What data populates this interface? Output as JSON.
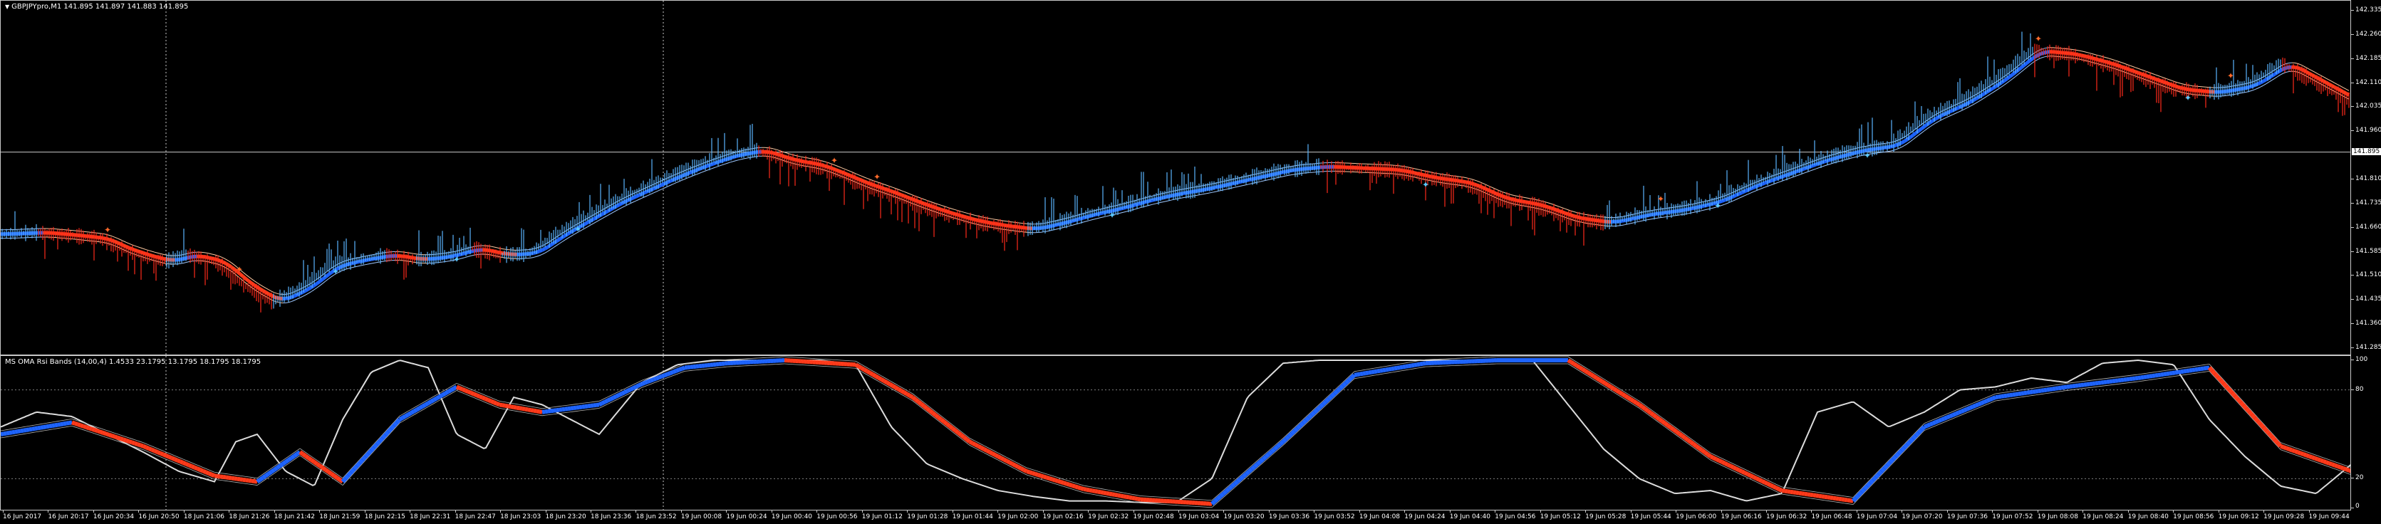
{
  "price_pane": {
    "title": "GBPJPYpro,M1  141.895 141.897 141.883 141.895",
    "collapse_arrow": "▼",
    "axis_ticks": [
      "142.335",
      "142.260",
      "142.185",
      "142.110",
      "142.035",
      "141.960",
      "141.810",
      "141.735",
      "141.660",
      "141.585",
      "141.510",
      "141.435",
      "141.360",
      "141.285"
    ],
    "axis_values": [
      142.335,
      142.26,
      142.185,
      142.11,
      142.035,
      141.96,
      141.81,
      141.735,
      141.66,
      141.585,
      141.51,
      141.435,
      141.36,
      141.285
    ],
    "current_price_label": "141.895",
    "current_price": 141.895,
    "y_range": [
      141.285,
      142.335
    ]
  },
  "osc_pane": {
    "title": "MS OMA Rsi Bands (14,00,4) 1.4533 23.1795 13.1795 18.1795 18.1795",
    "axis_ticks": [
      "100",
      "80",
      "20",
      "0"
    ],
    "axis_values": [
      100,
      80,
      20,
      0
    ],
    "levels": [
      80,
      20
    ]
  },
  "time_axis": {
    "labels": [
      "16 Jun 2017",
      "16 Jun 20:17",
      "16 Jun 20:34",
      "16 Jun 20:50",
      "18 Jun 21:06",
      "18 Jun 21:26",
      "18 Jun 21:42",
      "18 Jun 21:59",
      "18 Jun 22:15",
      "18 Jun 22:31",
      "18 Jun 22:47",
      "18 Jun 23:03",
      "18 Jun 23:20",
      "18 Jun 23:36",
      "18 Jun 23:52",
      "19 Jun 00:08",
      "19 Jun 00:24",
      "19 Jun 00:40",
      "19 Jun 00:56",
      "19 Jun 01:12",
      "19 Jun 01:28",
      "19 Jun 01:44",
      "19 Jun 02:00",
      "19 Jun 02:16",
      "19 Jun 02:32",
      "19 Jun 02:48",
      "19 Jun 03:04",
      "19 Jun 03:20",
      "19 Jun 03:36",
      "19 Jun 03:52",
      "19 Jun 04:08",
      "19 Jun 04:24",
      "19 Jun 04:40",
      "19 Jun 04:56",
      "19 Jun 05:12",
      "19 Jun 05:28",
      "19 Jun 05:44",
      "19 Jun 06:00",
      "19 Jun 06:16",
      "19 Jun 06:32",
      "19 Jun 06:48",
      "19 Jun 07:04",
      "19 Jun 07:20",
      "19 Jun 07:36",
      "19 Jun 07:52",
      "19 Jun 08:08",
      "19 Jun 08:24",
      "19 Jun 08:40",
      "19 Jun 08:56",
      "19 Jun 09:12",
      "19 Jun 09:28",
      "19 Jun 09:44"
    ]
  },
  "colors": {
    "background": "#000000",
    "grid_line": "#c8c8c8",
    "bull_candle": "#5ab4ff",
    "bear_candle": "#ff2a1a",
    "band_up": "#1e64ff",
    "band_down": "#ff3a1a",
    "band_border_up": "#9ec8ff",
    "band_border_down": "#ffc8a0",
    "rsi_line": "#dcdcdc",
    "arrow_up": "#5ac8ff",
    "arrow_down": "#ff6a2a"
  },
  "chart_data": [
    {
      "type": "line",
      "name": "price",
      "ylim": [
        141.285,
        142.335
      ],
      "x_index": [
        0,
        50,
        100,
        140,
        160,
        200,
        230,
        260,
        300,
        340,
        380,
        420,
        460,
        500,
        540,
        580,
        620,
        660,
        700,
        740,
        780,
        820,
        860,
        900,
        940,
        980,
        1020,
        1060,
        1100,
        1140,
        1180,
        1200,
        1240,
        1280,
        1320,
        1360,
        1400,
        1440,
        1480,
        1520,
        1560,
        1600,
        1640,
        1680,
        1720,
        1760,
        1800,
        1850
      ],
      "values": [
        141.64,
        141.645,
        141.635,
        141.625,
        141.6,
        141.57,
        141.555,
        141.575,
        141.555,
        141.48,
        141.43,
        141.47,
        141.54,
        141.56,
        141.575,
        141.56,
        141.57,
        141.595,
        141.575,
        141.58,
        141.64,
        141.69,
        141.74,
        141.78,
        141.82,
        141.855,
        141.885,
        141.9,
        141.87,
        141.855,
        141.82,
        141.8,
        141.77,
        141.735,
        141.705,
        141.68,
        141.665,
        141.655,
        141.675,
        141.7,
        141.72,
        141.745,
        141.765,
        141.78,
        141.8,
        141.82,
        141.84,
        141.85
      ]
    },
    {
      "type": "line",
      "name": "price-late",
      "x_index": [
        1850,
        1900,
        1950,
        2000,
        2050,
        2100,
        2150,
        2200,
        2250,
        2300,
        2350,
        2400,
        2450,
        2500,
        2550,
        2600,
        2650,
        2700,
        2750,
        2800,
        2850,
        2900,
        2950,
        3000,
        3050,
        3100,
        3150,
        3200,
        3250,
        3300
      ],
      "values": [
        141.85,
        141.845,
        141.84,
        141.815,
        141.8,
        141.75,
        141.73,
        141.69,
        141.675,
        141.7,
        141.715,
        141.74,
        141.79,
        141.83,
        141.87,
        141.9,
        141.915,
        142.0,
        142.05,
        142.12,
        142.21,
        142.2,
        142.17,
        142.13,
        142.09,
        142.08,
        142.1,
        142.17,
        142.11,
        142.05
      ]
    },
    {
      "type": "line",
      "name": "rsi-oscillator",
      "ylim": [
        0,
        100
      ],
      "x_index": [
        0,
        50,
        100,
        150,
        200,
        250,
        300,
        330,
        360,
        400,
        440,
        480,
        520,
        560,
        600,
        640,
        680,
        720,
        760,
        800,
        840,
        900,
        950,
        1000,
        1050,
        1100,
        1150,
        1200,
        1250,
        1300,
        1350,
        1400,
        1450,
        1500,
        1550,
        1600,
        1650,
        1700,
        1750,
        1800,
        1850,
        1900,
        1950,
        2000,
        2050,
        2100,
        2150,
        2200,
        2250,
        2300,
        2350,
        2400,
        2450,
        2500,
        2550,
        2600,
        2650,
        2700,
        2750,
        2800,
        2850,
        2900,
        2950,
        3000,
        3050,
        3100,
        3150,
        3200,
        3250,
        3300
      ],
      "values": [
        55,
        65,
        62,
        50,
        38,
        25,
        18,
        45,
        50,
        25,
        15,
        60,
        92,
        100,
        95,
        50,
        40,
        75,
        70,
        60,
        50,
        85,
        97,
        100,
        100,
        100,
        100,
        97,
        55,
        30,
        20,
        12,
        8,
        5,
        5,
        4,
        4,
        20,
        75,
        98,
        100,
        100,
        100,
        100,
        100,
        100,
        100,
        70,
        40,
        20,
        10,
        12,
        5,
        10,
        65,
        72,
        55,
        65,
        80,
        82,
        88,
        85,
        98,
        100,
        97,
        60,
        35,
        15,
        10,
        30
      ]
    },
    {
      "type": "line",
      "name": "oma-band",
      "ylim": [
        0,
        100
      ],
      "x_index": [
        0,
        100,
        200,
        300,
        360,
        420,
        480,
        560,
        640,
        700,
        760,
        840,
        900,
        960,
        1020,
        1100,
        1200,
        1280,
        1360,
        1440,
        1520,
        1600,
        1700,
        1800,
        1900,
        2000,
        2100,
        2200,
        2300,
        2400,
        2500,
        2600,
        2700,
        2800,
        2900,
        3000,
        3100,
        3200,
        3300
      ],
      "values": [
        50,
        58,
        42,
        22,
        18,
        38,
        18,
        60,
        82,
        70,
        65,
        70,
        84,
        95,
        98,
        100,
        97,
        75,
        45,
        25,
        13,
        6,
        3,
        45,
        90,
        98,
        100,
        100,
        70,
        35,
        12,
        5,
        55,
        75,
        82,
        88,
        95,
        42,
        25
      ]
    }
  ]
}
